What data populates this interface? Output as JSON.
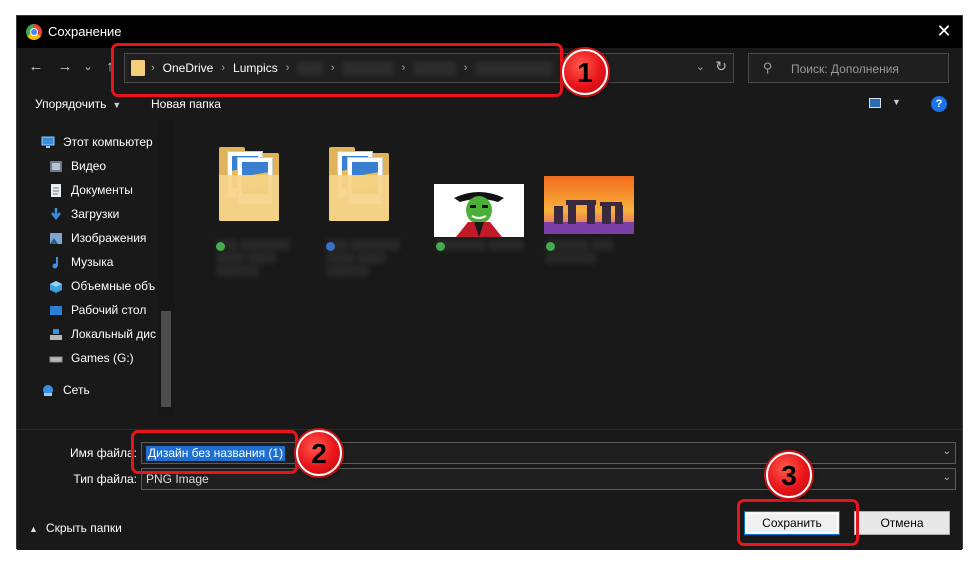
{
  "window": {
    "title": "Сохранение",
    "close_glyph": "✕"
  },
  "nav": {
    "back_glyph": "←",
    "forward_glyph": "→",
    "recent_glyph": "⌄",
    "up_glyph": "↑",
    "breadcrumbs": [
      "OneDrive",
      "Lumpics"
    ],
    "breadcrumb_separator": "›",
    "dropdown_glyph": "⌄",
    "refresh_glyph": "↻"
  },
  "search": {
    "placeholder": "Поиск: Дополнения",
    "icon_glyph": "⚲"
  },
  "toolbar": {
    "organize_label": "Упорядочить",
    "organize_caret": "▼",
    "new_folder_label": "Новая папка",
    "view_caret": "▼",
    "help_glyph": "?"
  },
  "sidebar": {
    "items": [
      {
        "label": "Этот компьютер",
        "icon": "computer-icon"
      },
      {
        "label": "Видео",
        "icon": "video-icon"
      },
      {
        "label": "Документы",
        "icon": "documents-icon"
      },
      {
        "label": "Загрузки",
        "icon": "downloads-icon"
      },
      {
        "label": "Изображения",
        "icon": "pictures-icon"
      },
      {
        "label": "Музыка",
        "icon": "music-icon"
      },
      {
        "label": "Объемные объ",
        "icon": "3d-objects-icon"
      },
      {
        "label": "Рабочий стол",
        "icon": "desktop-icon"
      },
      {
        "label": "Локальный дис",
        "icon": "local-disk-icon"
      },
      {
        "label": "Games (G:)",
        "icon": "drive-icon"
      },
      {
        "label": "Сеть",
        "icon": "network-icon"
      }
    ]
  },
  "content": {
    "items": [
      {
        "type": "folder",
        "status_color": "#3fae49"
      },
      {
        "type": "folder",
        "status_color": "#2f6fd0"
      },
      {
        "type": "image",
        "subject": "green-mask-portrait",
        "status_color": "#3fae49"
      },
      {
        "type": "image",
        "subject": "stonehenge-sunset",
        "status_color": "#3fae49"
      }
    ]
  },
  "form": {
    "filename_label": "Имя файла:",
    "filename_value": "Дизайн без названия (1)",
    "filetype_label": "Тип файла:",
    "filetype_value": "PNG Image",
    "dropdown_glyph": "⌄"
  },
  "footer": {
    "hide_folders_caret": "▲",
    "hide_folders_label": "Скрыть папки",
    "save_label": "Сохранить",
    "cancel_label": "Отмена"
  },
  "annotations": {
    "color": "#e8141b",
    "step1": "1",
    "step2": "2",
    "step3": "3"
  }
}
